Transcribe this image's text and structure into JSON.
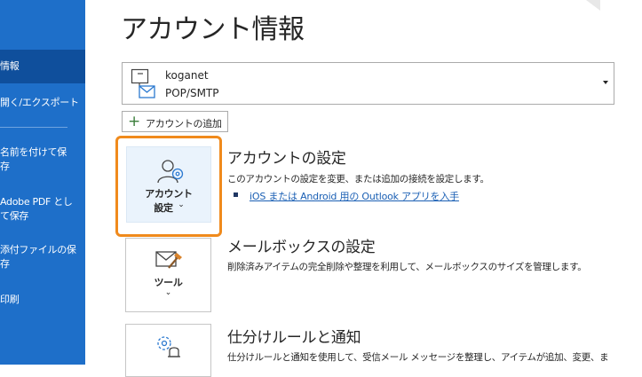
{
  "sidebar": {
    "items": [
      {
        "label": "情報"
      },
      {
        "label": "開く/エクスポート"
      },
      {
        "label_line1": "名前を付けて保",
        "label_line2": "存"
      },
      {
        "label_line1": "Adobe PDF とし",
        "label_line2": "て保存"
      },
      {
        "label_line1": "添付ファイルの保",
        "label_line2": "存"
      },
      {
        "label": "印刷"
      }
    ]
  },
  "page": {
    "title": "アカウント情報"
  },
  "account": {
    "name": "koganet",
    "type": "POP/SMTP"
  },
  "add_account": {
    "label": "アカウントの追加"
  },
  "account_settings": {
    "tile_line1": "アカウント",
    "tile_line2": "設定",
    "chevron": "⌄",
    "title": "アカウントの設定",
    "desc": "このアカウントの設定を変更、または追加の接続を設定します。",
    "link": "iOS または Android 用の Outlook アプリを入手"
  },
  "mailbox_settings": {
    "tile_label": "ツール",
    "chevron": "⌄",
    "title": "メールボックスの設定",
    "desc": "削除済みアイテムの完全削除や整理を利用して、メールボックスのサイズを管理します。"
  },
  "rules": {
    "title": "仕分けルールと通知",
    "desc": "仕分けルールと通知を使用して、受信メール メッセージを整理し、アイテムが追加、変更、ま"
  },
  "icons": {
    "account": "mail-account-icon",
    "add": "plus-icon",
    "person_gear": "person-gear-icon",
    "mailbox_tools": "mailbox-tools-icon",
    "rules_bell": "gear-bell-icon"
  },
  "colors": {
    "sidebar": "#1e6fc9",
    "highlight": "#f08a1c",
    "link": "#1a5fb4"
  }
}
